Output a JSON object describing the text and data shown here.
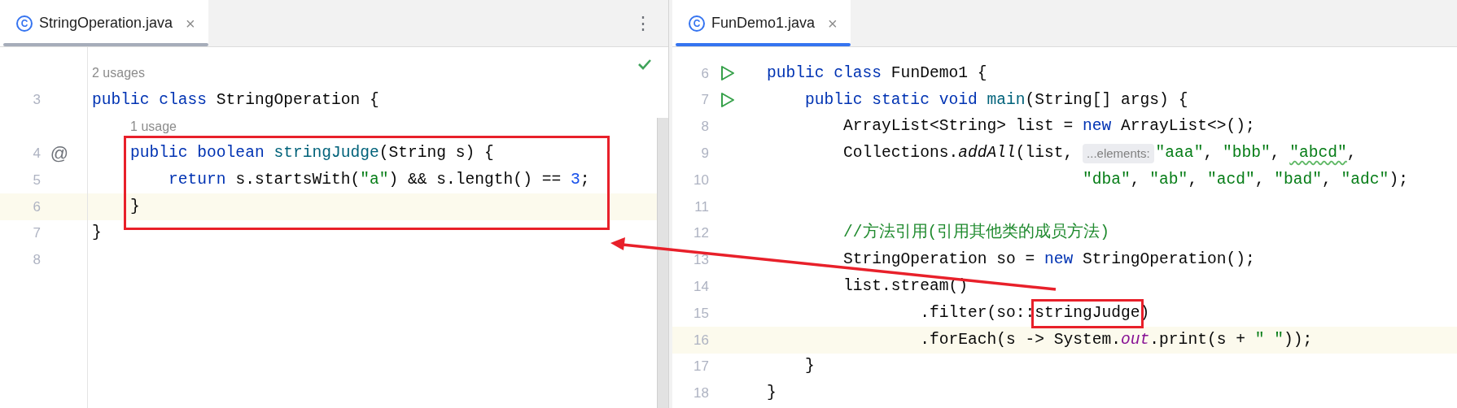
{
  "left_pane": {
    "focused": false,
    "tab": {
      "icon": "C",
      "label": "StringOperation.java",
      "close": "×",
      "selected": true
    },
    "more_menu": "⋮",
    "inspection_ok": true,
    "lines": [
      {
        "usage": "2 usages",
        "current": false
      },
      {
        "number": "3",
        "current": false,
        "tokens": [
          {
            "kind": "keyword",
            "text": "public class "
          },
          {
            "kind": "plain",
            "text": "StringOperation {"
          }
        ]
      },
      {
        "usage": "1 usage",
        "current": false
      },
      {
        "number": "4",
        "gutter_icon": "@",
        "current": false,
        "tokens": [
          {
            "kind": "keyword",
            "text": "    public boolean "
          },
          {
            "kind": "declaration",
            "text": "stringJudge"
          },
          {
            "kind": "plain",
            "text": "(String s) {"
          }
        ]
      },
      {
        "number": "5",
        "current": false,
        "tokens": [
          {
            "kind": "keyword",
            "text": "        return "
          },
          {
            "kind": "plain",
            "text": "s.startsWith("
          },
          {
            "kind": "string",
            "text": "\"a\""
          },
          {
            "kind": "plain",
            "text": ") && s.length() == "
          },
          {
            "kind": "number",
            "text": "3"
          },
          {
            "kind": "plain",
            "text": ";"
          }
        ]
      },
      {
        "number": "6",
        "current": true,
        "tokens": [
          {
            "kind": "plain",
            "text": "    }"
          }
        ]
      },
      {
        "number": "7",
        "current": false,
        "tokens": [
          {
            "kind": "plain",
            "text": "}"
          }
        ]
      },
      {
        "number": "8",
        "current": false
      }
    ]
  },
  "right_pane": {
    "focused": true,
    "tab": {
      "icon": "C",
      "label": "FunDemo1.java",
      "close": "×",
      "selected": true
    },
    "lines": [
      {
        "number": "6",
        "run": true,
        "current": false,
        "tokens": [
          {
            "kind": "keyword",
            "text": "public class "
          },
          {
            "kind": "plain",
            "text": "FunDemo1 {"
          }
        ]
      },
      {
        "number": "7",
        "run": true,
        "current": false,
        "tokens": [
          {
            "kind": "keyword",
            "text": "    public static void "
          },
          {
            "kind": "declaration",
            "text": "main"
          },
          {
            "kind": "plain",
            "text": "(String[] args) {"
          }
        ]
      },
      {
        "number": "8",
        "current": false,
        "tokens": [
          {
            "kind": "plain",
            "text": "        ArrayList<String> list = "
          },
          {
            "kind": "keyword",
            "text": "new "
          },
          {
            "kind": "plain",
            "text": "ArrayList<>();"
          }
        ]
      },
      {
        "number": "9",
        "current": false,
        "tokens": [
          {
            "kind": "plain",
            "text": "        Collections."
          },
          {
            "kind": "static",
            "text": "addAll"
          },
          {
            "kind": "plain",
            "text": "(list, "
          },
          {
            "kind": "hint",
            "text": "...elements:"
          },
          {
            "kind": "string",
            "text": "\"aaa\""
          },
          {
            "kind": "plain",
            "text": ", "
          },
          {
            "kind": "string",
            "text": "\"bbb\""
          },
          {
            "kind": "plain",
            "text": ", "
          },
          {
            "kind": "string",
            "text": "\"abcd\"",
            "typo": true
          },
          {
            "kind": "plain",
            "text": ","
          }
        ]
      },
      {
        "number": "10",
        "current": false,
        "tokens": [
          {
            "kind": "string",
            "text": "                                 \"dba\""
          },
          {
            "kind": "plain",
            "text": ", "
          },
          {
            "kind": "string",
            "text": "\"ab\""
          },
          {
            "kind": "plain",
            "text": ", "
          },
          {
            "kind": "string",
            "text": "\"acd\""
          },
          {
            "kind": "plain",
            "text": ", "
          },
          {
            "kind": "string",
            "text": "\"bad\""
          },
          {
            "kind": "plain",
            "text": ", "
          },
          {
            "kind": "string",
            "text": "\"adc\""
          },
          {
            "kind": "plain",
            "text": ");"
          }
        ]
      },
      {
        "number": "11",
        "current": false
      },
      {
        "number": "12",
        "current": false,
        "tokens": [
          {
            "kind": "comment",
            "text": "        //方法引用(引用其他类的成员方法)"
          }
        ]
      },
      {
        "number": "13",
        "current": false,
        "tokens": [
          {
            "kind": "plain",
            "text": "        StringOperation so = "
          },
          {
            "kind": "keyword",
            "text": "new "
          },
          {
            "kind": "plain",
            "text": "StringOperation();"
          }
        ]
      },
      {
        "number": "14",
        "current": false,
        "tokens": [
          {
            "kind": "plain",
            "text": "        list.stream()"
          }
        ]
      },
      {
        "number": "15",
        "current": false,
        "tokens": [
          {
            "kind": "plain",
            "text": "                .filter(so::stringJudge)"
          }
        ]
      },
      {
        "number": "16",
        "current": true,
        "tokens": [
          {
            "kind": "plain",
            "text": "                .forEach(s -> System."
          },
          {
            "kind": "field",
            "text": "out"
          },
          {
            "kind": "plain",
            "text": ".print(s + "
          },
          {
            "kind": "string",
            "text": "\" \""
          },
          {
            "kind": "plain",
            "text": "));"
          }
        ]
      },
      {
        "number": "17",
        "current": false,
        "tokens": [
          {
            "kind": "plain",
            "text": "    }"
          }
        ]
      },
      {
        "number": "18",
        "current": false,
        "tokens": [
          {
            "kind": "plain",
            "text": "}"
          }
        ]
      }
    ]
  },
  "annotations": [
    {
      "kind": "box",
      "color": "#e8202a"
    },
    {
      "kind": "box",
      "color": "#e8202a"
    },
    {
      "kind": "arrow",
      "color": "#e8202a"
    }
  ]
}
